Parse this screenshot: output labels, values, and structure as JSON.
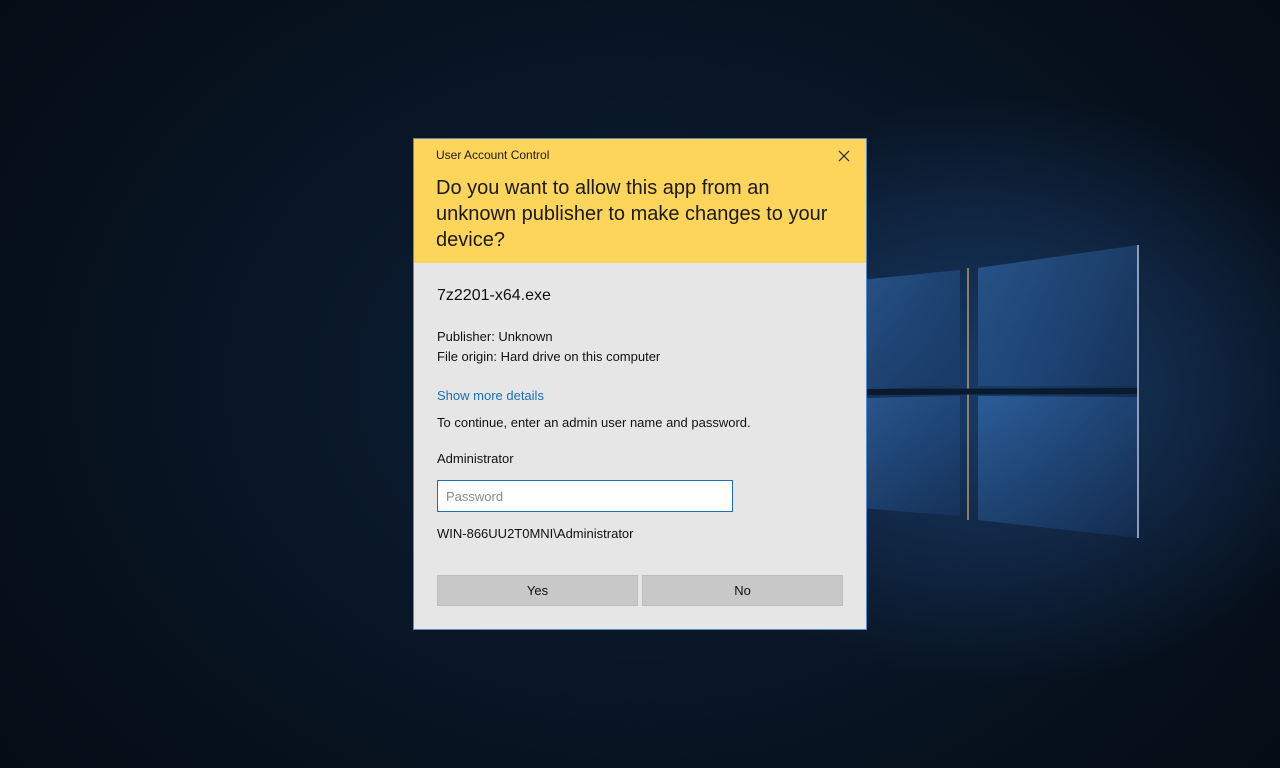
{
  "dialog": {
    "window_title": "User Account Control",
    "question": "Do you want to allow this app from an unknown publisher to make changes to your device?",
    "app_name": "7z2201-x64.exe",
    "publisher": "Publisher: Unknown",
    "file_origin": "File origin: Hard drive on this computer",
    "show_more_link": "Show more details",
    "continue_prompt": "To continue, enter an admin user name and password.",
    "username": "Administrator",
    "password": {
      "placeholder": "Password",
      "value": ""
    },
    "account": "WIN-866UU2T0MNI\\Administrator",
    "yes_label": "Yes",
    "no_label": "No",
    "header_color": "#fdd55a",
    "link_color": "#1a6fb8",
    "close_icon": "close-icon"
  },
  "background": {
    "logo_icon": "windows-logo-icon"
  }
}
